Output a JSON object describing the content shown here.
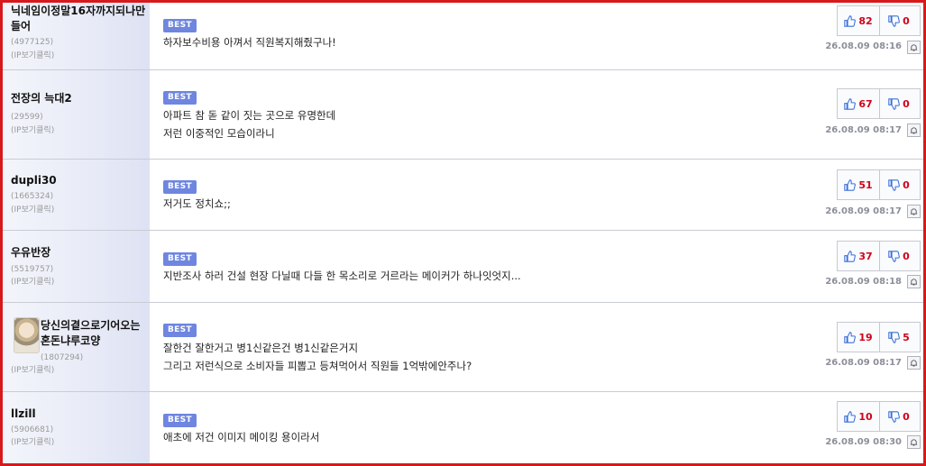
{
  "comments": [
    {
      "nickname": "닉네임이정말16자까지되나만들어",
      "user_id": "(4977125)",
      "ip": "(IP보기클릭)",
      "badge": "BEST",
      "lines": [
        "하자보수비용 아껴서 직원복지해줬구나!"
      ],
      "upvotes": "82",
      "downvotes": "0",
      "date": "26.08.09 08:16"
    },
    {
      "nickname": "전장의 늑대2",
      "user_id": "(29599)",
      "ip": "(IP보기클릭)",
      "badge": "BEST",
      "lines": [
        "아파트 참 돋 같이 짓는 곳으로 유명한데",
        "저런 이중적인 모습이라니"
      ],
      "upvotes": "67",
      "downvotes": "0",
      "date": "26.08.09 08:17"
    },
    {
      "nickname": "dupli30",
      "user_id": "(1665324)",
      "ip": "(IP보기클릭)",
      "badge": "BEST",
      "lines": [
        "저거도 정치쇼;;"
      ],
      "upvotes": "51",
      "downvotes": "0",
      "date": "26.08.09 08:17"
    },
    {
      "nickname": "우유반장",
      "user_id": "(5519757)",
      "ip": "(IP보기클릭)",
      "badge": "BEST",
      "lines": [
        "지반조사 하러 건설 현장 다닐때 다들 한 목소리로 거르라는 메이커가 하나잇엇지..."
      ],
      "upvotes": "37",
      "downvotes": "0",
      "date": "26.08.09 08:18"
    },
    {
      "nickname": "당신의곁으로기어오는혼돈냐루코양",
      "user_id": "(1807294)",
      "ip": "(IP보기클릭)",
      "badge": "BEST",
      "lines": [
        "잘한건 잘한거고 병1신같은건 병1신같은거지",
        "그리고 저런식으로 소비자들 피뽑고 등쳐먹어서 직원들 1억밖에안주나?"
      ],
      "upvotes": "19",
      "downvotes": "5",
      "date": "26.08.09 08:17"
    },
    {
      "nickname": "llzill",
      "user_id": "(5906681)",
      "ip": "(IP보기클릭)",
      "badge": "BEST",
      "lines": [
        "애초에 저건 이미지 메이킹 용이라서"
      ],
      "upvotes": "10",
      "downvotes": "0",
      "date": "26.08.09 08:30"
    }
  ],
  "colors": {
    "frame_border": "#d7191c",
    "best_badge": "#6e86e0",
    "vote_count": "#d0021b",
    "thumb_icon": "#3a6fd8"
  },
  "icons": {
    "upvote": "thumbs-up-icon",
    "downvote": "thumbs-down-icon",
    "report": "bell-icon"
  }
}
